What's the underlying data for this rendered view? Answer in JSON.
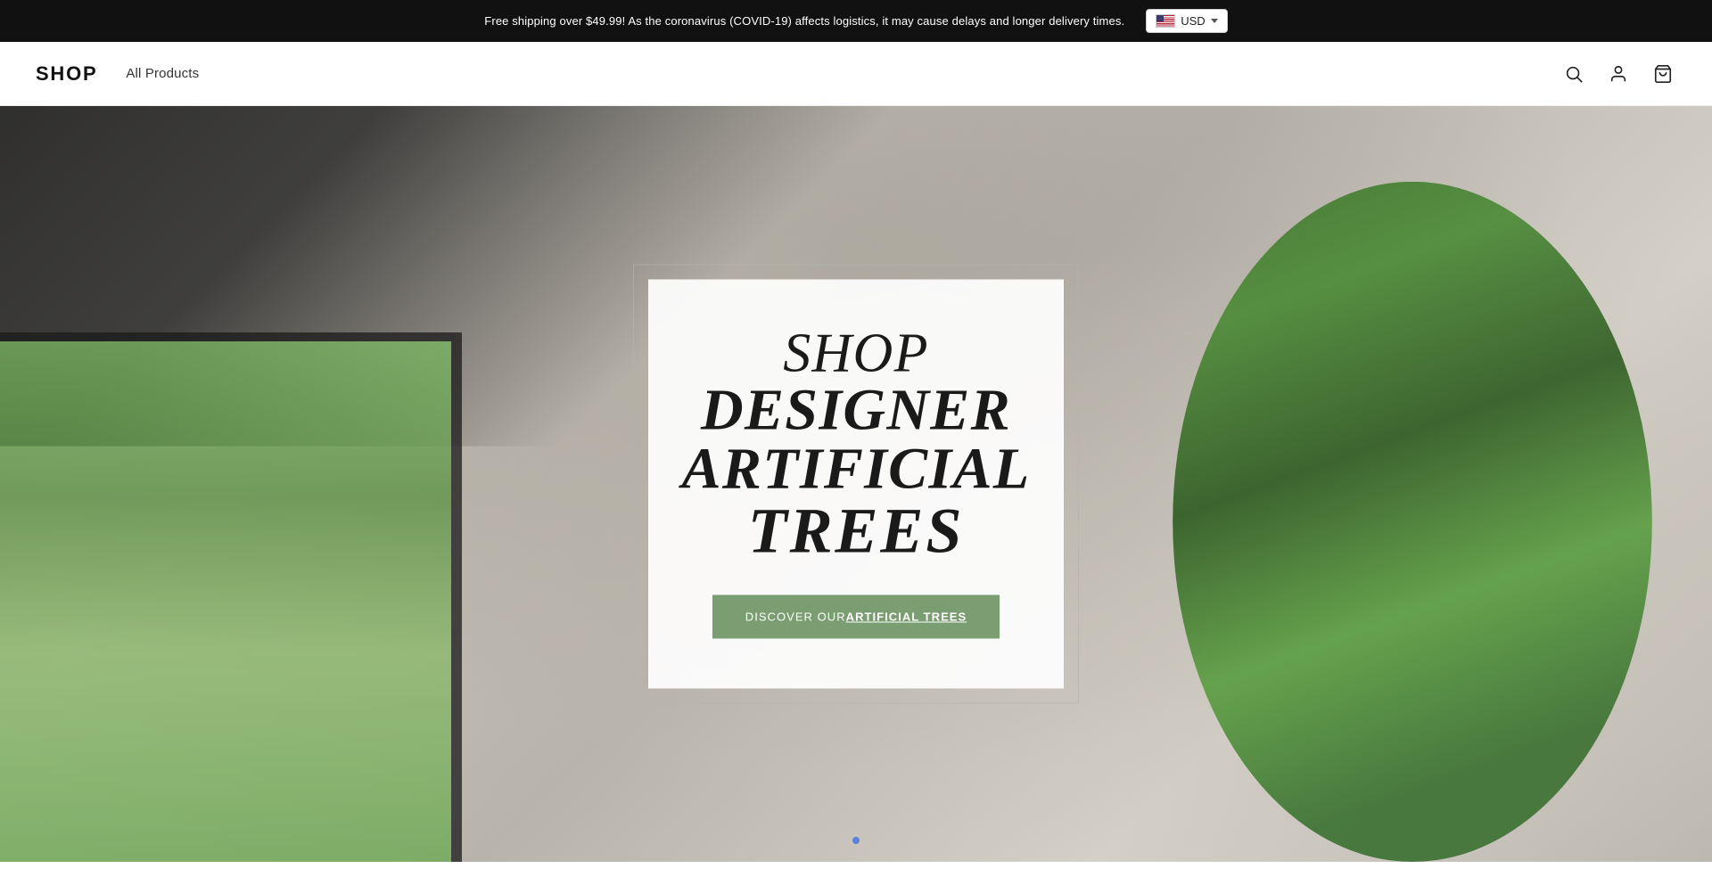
{
  "announcement": {
    "text": "Free shipping over $49.99! As the coronavirus (COVID-19) affects logistics, it may cause delays and longer delivery times.",
    "currency_label": "USD",
    "currency_flag": "us"
  },
  "header": {
    "logo": "SHOP",
    "nav": [
      {
        "label": "All Products",
        "id": "all-products"
      }
    ],
    "icons": {
      "search": "search-icon",
      "account": "account-icon",
      "cart": "cart-icon"
    }
  },
  "hero": {
    "title_line1": "SHOP",
    "title_line2": "DESIGNER",
    "title_line3": "ARTIFICIAL",
    "title_line4": "TREES",
    "cta_prefix": "DISCOVER OUR ",
    "cta_bold": "ARTIFICIAL TREES",
    "dots": [
      {
        "active": true
      }
    ]
  }
}
